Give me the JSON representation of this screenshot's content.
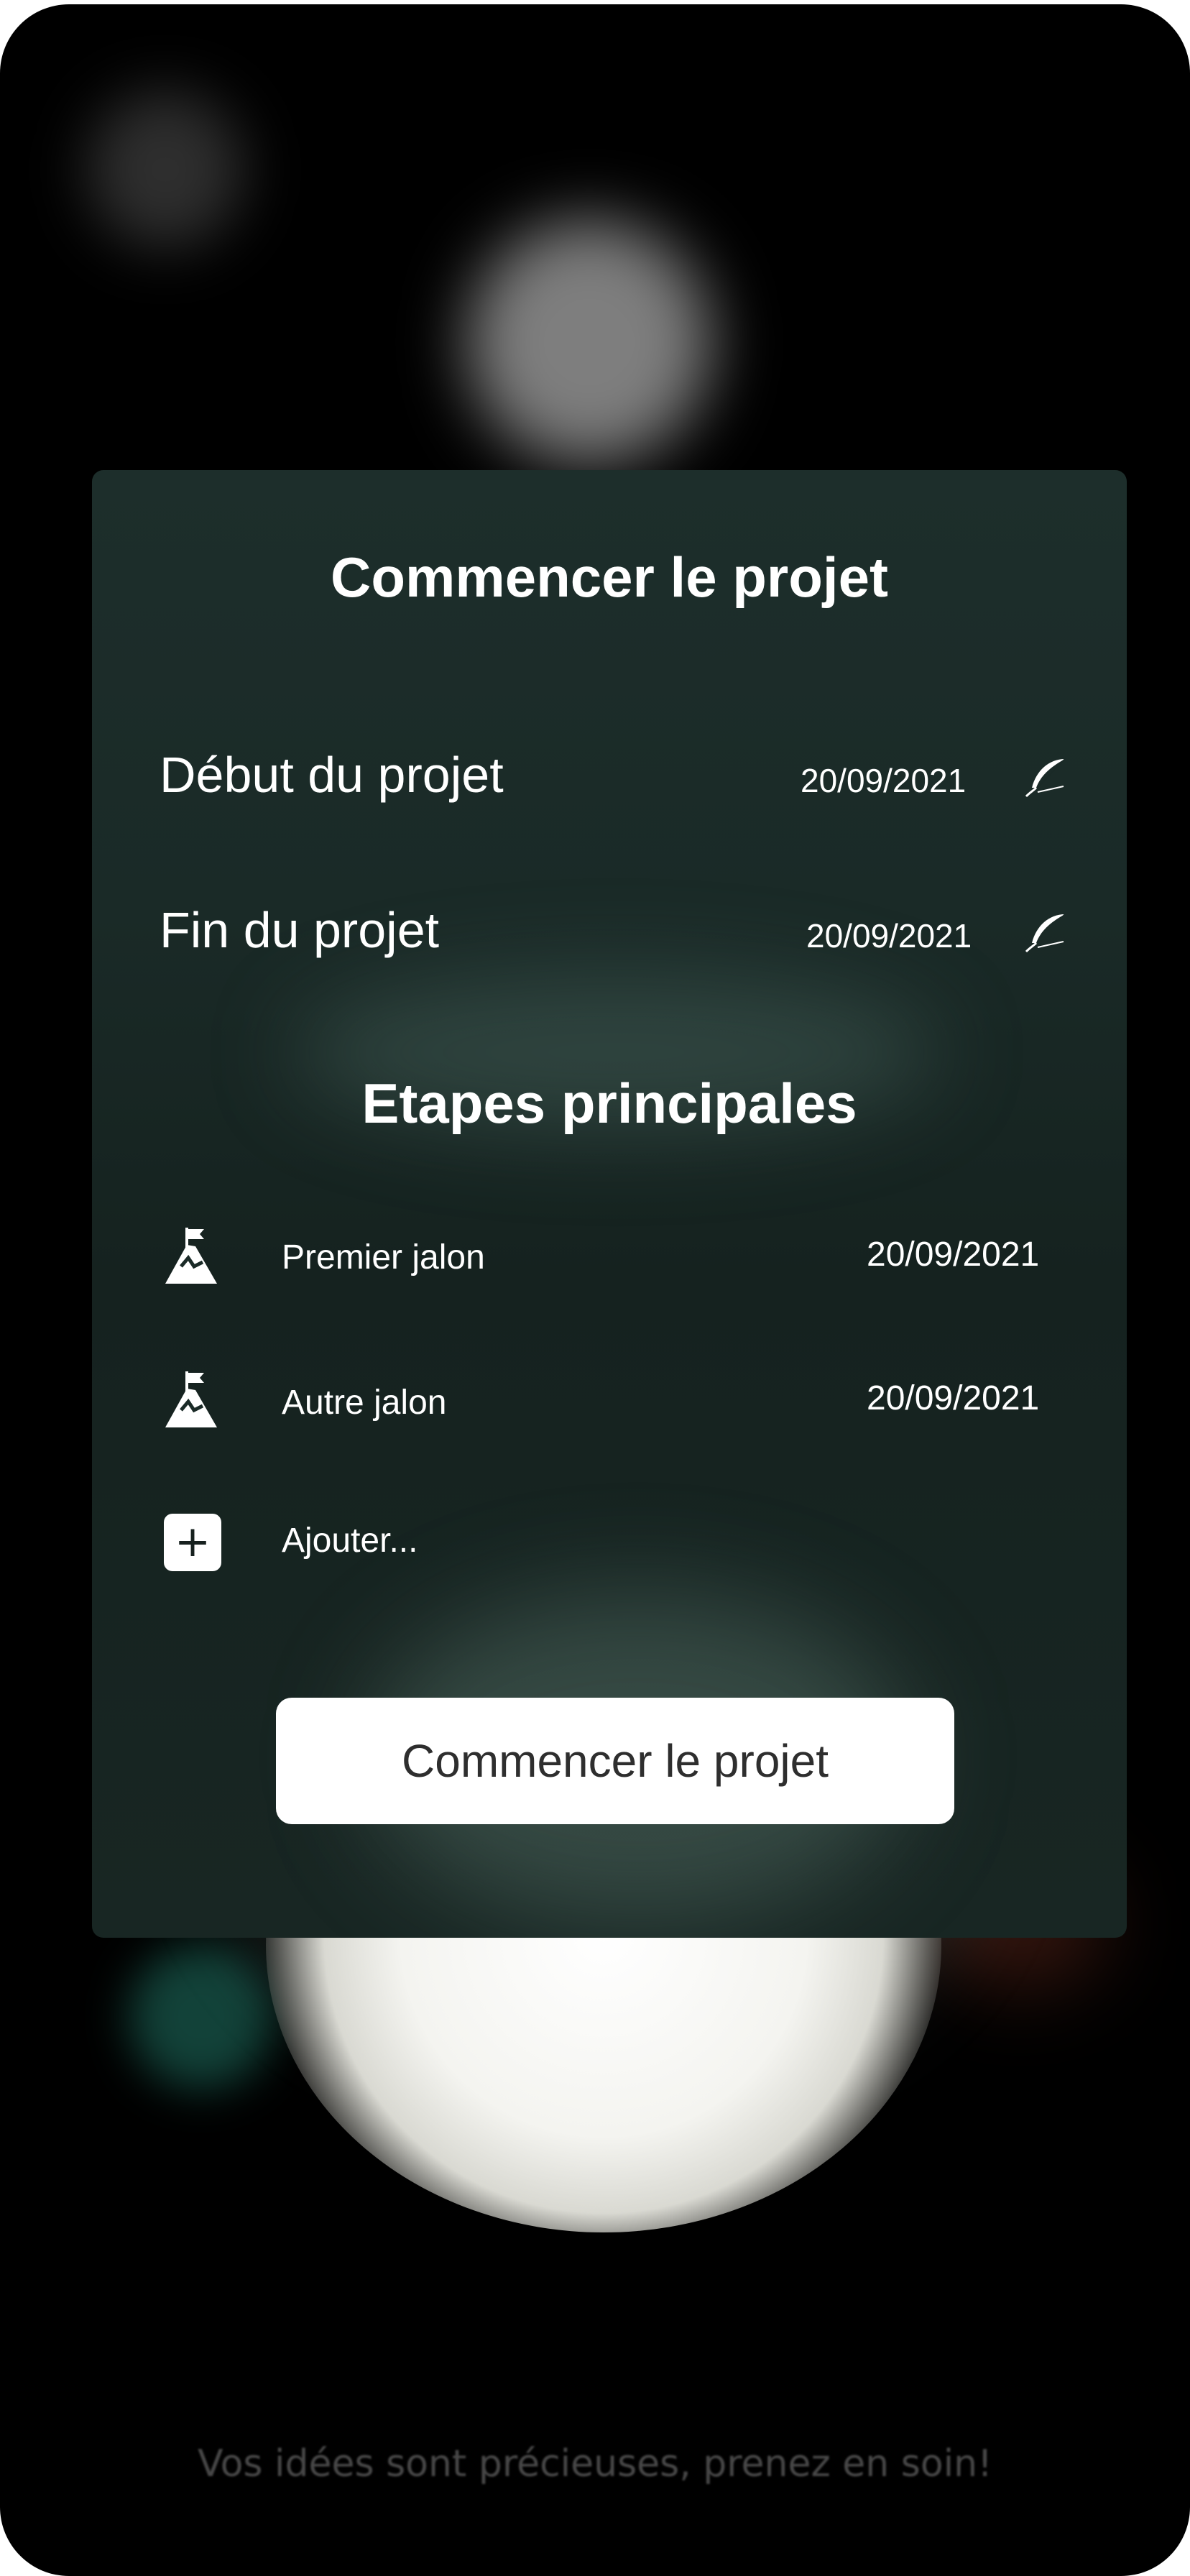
{
  "dialog": {
    "title": "Commencer le projet",
    "start": {
      "label": "Début du projet",
      "date": "20/09/2021",
      "edit_icon": "feather-icon"
    },
    "end": {
      "label": "Fin du projet",
      "date": "20/09/2021",
      "edit_icon": "feather-icon"
    },
    "milestones_title": "Etapes principales",
    "milestones": [
      {
        "label": "Premier jalon",
        "date": "20/09/2021",
        "icon": "summit-flag-icon"
      },
      {
        "label": "Autre jalon",
        "date": "20/09/2021",
        "icon": "summit-flag-icon"
      }
    ],
    "add_label": "Ajouter...",
    "add_icon": "plus-icon",
    "cta_label": "Commencer le projet"
  },
  "footer": {
    "tagline": "Vos idées sont précieuses, prenez en soin!"
  },
  "colors": {
    "card_bg": "#1a2a27",
    "background": "#000000",
    "text": "#ffffff",
    "button_bg": "#ffffff",
    "button_text": "#2e2e2e"
  }
}
